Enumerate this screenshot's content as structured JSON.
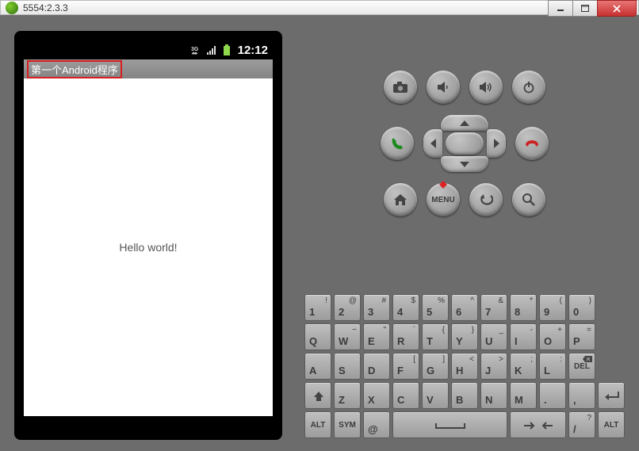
{
  "window": {
    "title": "5554:2.3.3"
  },
  "phone": {
    "status": {
      "time": "12:12"
    },
    "app_title": "第一个Android程序",
    "body_text": "Hello world!"
  },
  "controls": {
    "menu_label": "MENU"
  },
  "keyboard": {
    "row1": [
      {
        "m": "1",
        "a": "!"
      },
      {
        "m": "2",
        "a": "@"
      },
      {
        "m": "3",
        "a": "#"
      },
      {
        "m": "4",
        "a": "$"
      },
      {
        "m": "5",
        "a": "%"
      },
      {
        "m": "6",
        "a": "^"
      },
      {
        "m": "7",
        "a": "&"
      },
      {
        "m": "8",
        "a": "*"
      },
      {
        "m": "9",
        "a": "("
      },
      {
        "m": "0",
        "a": ")"
      }
    ],
    "row2": [
      {
        "m": "Q",
        "a": ""
      },
      {
        "m": "W",
        "a": "~"
      },
      {
        "m": "E",
        "a": "\""
      },
      {
        "m": "R",
        "a": "`"
      },
      {
        "m": "T",
        "a": "{"
      },
      {
        "m": "Y",
        "a": "}"
      },
      {
        "m": "U",
        "a": "_"
      },
      {
        "m": "I",
        "a": "-"
      },
      {
        "m": "O",
        "a": "+"
      },
      {
        "m": "P",
        "a": "="
      }
    ],
    "row3": [
      {
        "m": "A",
        "a": ""
      },
      {
        "m": "S",
        "a": ""
      },
      {
        "m": "D",
        "a": ""
      },
      {
        "m": "F",
        "a": "["
      },
      {
        "m": "G",
        "a": "]"
      },
      {
        "m": "H",
        "a": "<"
      },
      {
        "m": "J",
        "a": ">"
      },
      {
        "m": "K",
        "a": ";"
      },
      {
        "m": "L",
        "a": ":"
      }
    ],
    "row3_del": "DEL",
    "row4": [
      {
        "m": "Z",
        "a": ""
      },
      {
        "m": "X",
        "a": ""
      },
      {
        "m": "C",
        "a": ""
      },
      {
        "m": "V",
        "a": ""
      },
      {
        "m": "B",
        "a": ""
      },
      {
        "m": "N",
        "a": ""
      },
      {
        "m": "M",
        "a": ""
      },
      {
        "m": ".",
        "a": ""
      },
      {
        "m": ",",
        "a": ""
      }
    ],
    "row5": {
      "alt_l": "ALT",
      "sym": "SYM",
      "at": "@",
      "slash": "/",
      "qmark": "?",
      "alt_r": "ALT"
    }
  }
}
